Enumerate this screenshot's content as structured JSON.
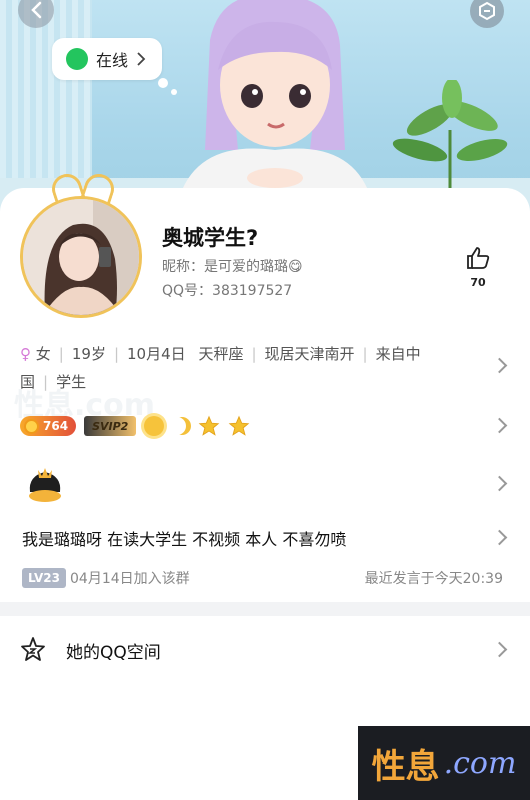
{
  "header": {
    "status_label": "在线"
  },
  "profile": {
    "nickname": "奥城学生?",
    "alias": "昵称：是可爱的璐璐😋",
    "qq": "QQ号：383197527",
    "likes": "70"
  },
  "info": {
    "items": [
      "女",
      "19岁",
      "10月4日",
      "天秤座",
      "现居天津南开",
      "来自中国",
      "学生"
    ]
  },
  "badges": {
    "level": "764",
    "svip": "SVIP2"
  },
  "signature": "我是璐璐呀 在读大学生  不视频 本人 不喜勿喷",
  "group": {
    "level": "LV23",
    "joined": "04月14日加入该群",
    "last_speak": "最近发言于今天20:39"
  },
  "qzone": {
    "label": "她的QQ空间"
  },
  "watermark": {
    "brand": "性息",
    "domain": ".com"
  },
  "colors": {
    "online": "#23c55e",
    "avatar_border": "#f0c35a",
    "female": "#d57ad7"
  }
}
